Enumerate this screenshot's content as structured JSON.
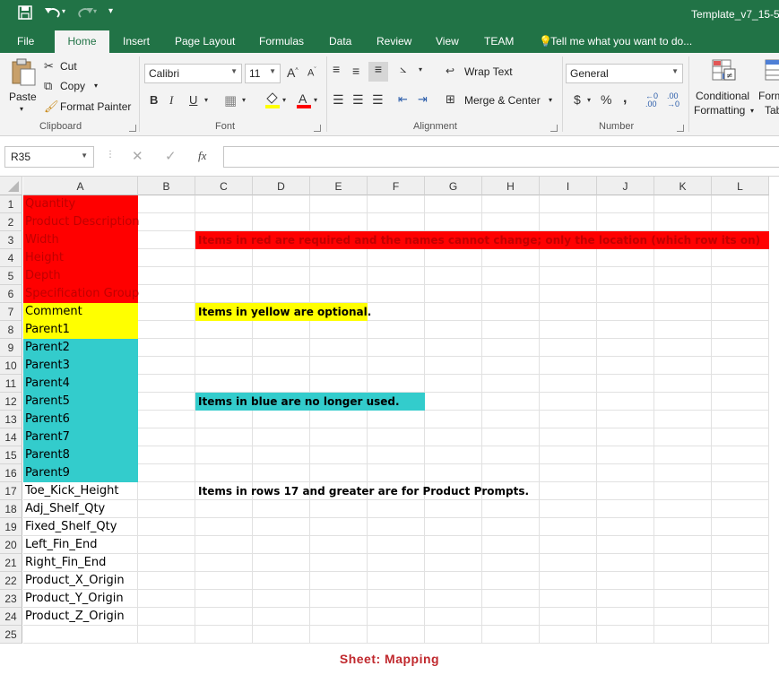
{
  "window": {
    "title": "Template_v7_15-5_"
  },
  "tabs": [
    "File",
    "Home",
    "Insert",
    "Page Layout",
    "Formulas",
    "Data",
    "Review",
    "View",
    "TEAM"
  ],
  "tell_me": "Tell me what you want to do...",
  "clipboard": {
    "paste": "Paste",
    "cut": "Cut",
    "copy": "Copy",
    "format_painter": "Format Painter",
    "label": "Clipboard"
  },
  "font": {
    "name": "Calibri",
    "size": "11",
    "bold": "B",
    "italic": "I",
    "underline": "U",
    "label": "Font"
  },
  "alignment": {
    "wrap_text": "Wrap Text",
    "merge_center": "Merge & Center",
    "label": "Alignment"
  },
  "number": {
    "format": "General",
    "currency": "$",
    "percent": "%",
    "comma": ",",
    "label": "Number"
  },
  "styles": {
    "conditional_line1": "Conditional",
    "conditional_line2": "Formatting",
    "format_table_line1": "Form",
    "format_table_line2": "Tab"
  },
  "formula_bar": {
    "name_box": "R35",
    "fx": "fx"
  },
  "columns": [
    "A",
    "B",
    "C",
    "D",
    "E",
    "F",
    "G",
    "H",
    "I",
    "J",
    "K",
    "L"
  ],
  "rows": [
    {
      "num": "1",
      "a": "Quantity",
      "fill": "red"
    },
    {
      "num": "2",
      "a": "Product Description",
      "fill": "red"
    },
    {
      "num": "3",
      "a": "Width",
      "fill": "red"
    },
    {
      "num": "4",
      "a": "Height",
      "fill": "red"
    },
    {
      "num": "5",
      "a": "Depth",
      "fill": "red"
    },
    {
      "num": "6",
      "a": "Specification Group",
      "fill": "red"
    },
    {
      "num": "7",
      "a": "Comment",
      "fill": "yellow"
    },
    {
      "num": "8",
      "a": "Parent1",
      "fill": "yellow"
    },
    {
      "num": "9",
      "a": "Parent2",
      "fill": "blue"
    },
    {
      "num": "10",
      "a": "Parent3",
      "fill": "blue"
    },
    {
      "num": "11",
      "a": "Parent4",
      "fill": "blue"
    },
    {
      "num": "12",
      "a": "Parent5",
      "fill": "blue"
    },
    {
      "num": "13",
      "a": "Parent6",
      "fill": "blue"
    },
    {
      "num": "14",
      "a": "Parent7",
      "fill": "blue"
    },
    {
      "num": "15",
      "a": "Parent8",
      "fill": "blue"
    },
    {
      "num": "16",
      "a": "Parent9",
      "fill": "blue"
    },
    {
      "num": "17",
      "a": "Toe_Kick_Height",
      "fill": "none"
    },
    {
      "num": "18",
      "a": "Adj_Shelf_Qty",
      "fill": "none"
    },
    {
      "num": "19",
      "a": "Fixed_Shelf_Qty",
      "fill": "none"
    },
    {
      "num": "20",
      "a": "Left_Fin_End",
      "fill": "none"
    },
    {
      "num": "21",
      "a": "Right_Fin_End",
      "fill": "none"
    },
    {
      "num": "22",
      "a": "Product_X_Origin",
      "fill": "none"
    },
    {
      "num": "23",
      "a": "Product_Y_Origin",
      "fill": "none"
    },
    {
      "num": "24",
      "a": "Product_Z_Origin",
      "fill": "none"
    },
    {
      "num": "25",
      "a": "",
      "fill": "none"
    }
  ],
  "notes": {
    "red": "Items in red are required and the names cannot change; only the location (which row its on)",
    "yellow": "Items in yellow are optional.",
    "blue": "Items in blue are no longer used.",
    "prompts": "Items in rows 17 and greater are for Product Prompts."
  },
  "colors": {
    "red": "#ff0000",
    "yellow": "#ffff00",
    "blue": "#33cccc",
    "red_text": "#c00000",
    "excel_green": "#217346"
  },
  "caption": "Sheet: Mapping"
}
